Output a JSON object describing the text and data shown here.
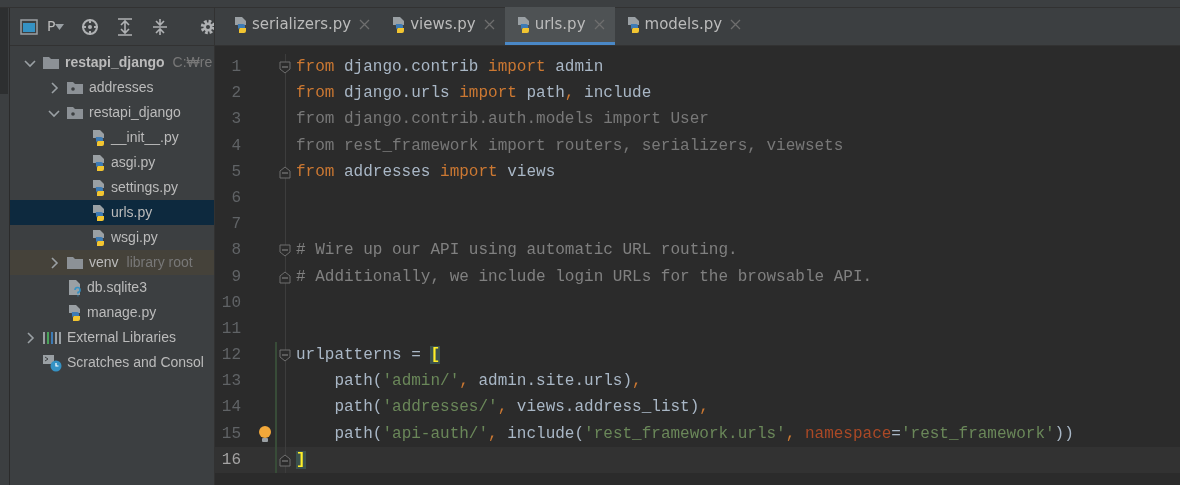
{
  "project_panel": {
    "view_label": "P"
  },
  "tree": [
    {
      "label": "restapi_django",
      "hint": "C:₩re",
      "kind": "project",
      "expanded": true,
      "selected": false,
      "children": [
        {
          "label": "addresses",
          "kind": "module",
          "expanded": false,
          "selected": false
        },
        {
          "label": "restapi_django",
          "kind": "module",
          "expanded": true,
          "selected": false,
          "children": [
            {
              "label": "__init__.py",
              "kind": "python",
              "selected": false
            },
            {
              "label": "asgi.py",
              "kind": "python",
              "selected": false
            },
            {
              "label": "settings.py",
              "kind": "python",
              "selected": false
            },
            {
              "label": "urls.py",
              "kind": "python",
              "selected": true
            },
            {
              "label": "wsgi.py",
              "kind": "python",
              "selected": false
            }
          ]
        },
        {
          "label": "venv",
          "hint": "library root",
          "kind": "library-folder",
          "expanded": false,
          "selected": false
        },
        {
          "label": "db.sqlite3",
          "kind": "unknown-file",
          "selected": false
        },
        {
          "label": "manage.py",
          "kind": "python",
          "selected": false
        }
      ]
    },
    {
      "label": "External Libraries",
      "kind": "libraries",
      "expanded": false,
      "selected": false
    },
    {
      "label": "Scratches and Consol",
      "kind": "scratches",
      "selected": false
    }
  ],
  "editor_tabs": [
    {
      "label": "serializers.py",
      "selected": false
    },
    {
      "label": "views.py",
      "selected": false
    },
    {
      "label": "urls.py",
      "selected": true
    },
    {
      "label": "models.py",
      "selected": false
    }
  ],
  "lines": [
    {
      "number": "1",
      "kind": "open",
      "current": false,
      "changed": false,
      "bulb": false,
      "tokens": [
        {
          "t": "from",
          "kind": "kw"
        },
        {
          "t": " django.contrib ",
          "kind": "id"
        },
        {
          "t": "import",
          "kind": "kw"
        },
        {
          "t": " admin",
          "kind": "id"
        }
      ]
    },
    {
      "number": "2",
      "kind": "plain",
      "current": false,
      "changed": false,
      "bulb": false,
      "tokens": [
        {
          "t": "from",
          "kind": "kw"
        },
        {
          "t": " django.urls ",
          "kind": "id"
        },
        {
          "t": "import",
          "kind": "kw"
        },
        {
          "t": " path",
          "kind": "id"
        },
        {
          "t": ",",
          "kind": "punct"
        },
        {
          "t": " include",
          "kind": "id"
        }
      ]
    },
    {
      "number": "3",
      "kind": "plain",
      "current": false,
      "changed": false,
      "bulb": false,
      "tokens": [
        {
          "t": "from django.contrib.auth.models import User",
          "kind": "unused"
        }
      ]
    },
    {
      "number": "4",
      "kind": "plain",
      "current": false,
      "changed": false,
      "bulb": false,
      "tokens": [
        {
          "t": "from rest_framework import routers, serializers, viewsets",
          "kind": "unused"
        }
      ]
    },
    {
      "number": "5",
      "kind": "close",
      "current": false,
      "changed": false,
      "bulb": false,
      "tokens": [
        {
          "t": "from",
          "kind": "kw"
        },
        {
          "t": " addresses ",
          "kind": "id"
        },
        {
          "t": "import",
          "kind": "kw"
        },
        {
          "t": " views",
          "kind": "id"
        }
      ]
    },
    {
      "number": "6",
      "kind": "plain",
      "current": false,
      "changed": false,
      "bulb": false
    },
    {
      "number": "7",
      "kind": "plain",
      "current": false,
      "changed": false,
      "bulb": false
    },
    {
      "number": "8",
      "kind": "open",
      "current": false,
      "changed": false,
      "bulb": false,
      "tokens": [
        {
          "t": "# Wire up our API using automatic URL routing.",
          "kind": "comment"
        }
      ]
    },
    {
      "number": "9",
      "kind": "close",
      "current": false,
      "changed": false,
      "bulb": false,
      "tokens": [
        {
          "t": "# Additionally, we include login URLs for the browsable API.",
          "kind": "comment"
        }
      ]
    },
    {
      "number": "10",
      "kind": "plain",
      "current": false,
      "changed": false,
      "bulb": false
    },
    {
      "number": "11",
      "kind": "plain",
      "current": false,
      "changed": false,
      "bulb": false
    },
    {
      "number": "12",
      "kind": "open",
      "current": false,
      "changed": true,
      "bulb": false,
      "tokens": [
        {
          "t": "urlpatterns = ",
          "kind": "id"
        },
        {
          "t": "[",
          "kind": "match"
        }
      ]
    },
    {
      "number": "13",
      "kind": "plain",
      "current": false,
      "changed": true,
      "bulb": false,
      "tokens": [
        {
          "t": "    path(",
          "kind": "id"
        },
        {
          "t": "'admin/'",
          "kind": "str"
        },
        {
          "t": ",",
          "kind": "punct"
        },
        {
          "t": " admin.site.urls)",
          "kind": "id"
        },
        {
          "t": ",",
          "kind": "punct"
        }
      ]
    },
    {
      "number": "14",
      "kind": "plain",
      "current": false,
      "changed": true,
      "bulb": false,
      "tokens": [
        {
          "t": "    path(",
          "kind": "id"
        },
        {
          "t": "'addresses/'",
          "kind": "str"
        },
        {
          "t": ",",
          "kind": "punct"
        },
        {
          "t": " views.address_list)",
          "kind": "id"
        },
        {
          "t": ",",
          "kind": "punct"
        }
      ]
    },
    {
      "number": "15",
      "kind": "plain",
      "current": false,
      "changed": true,
      "bulb": true,
      "tokens": [
        {
          "t": "    path(",
          "kind": "id"
        },
        {
          "t": "'api-auth/'",
          "kind": "str"
        },
        {
          "t": ",",
          "kind": "punct"
        },
        {
          "t": " include(",
          "kind": "id"
        },
        {
          "t": "'rest_framework.urls'",
          "kind": "str"
        },
        {
          "t": ", ",
          "kind": "punct"
        },
        {
          "t": "namespace",
          "kind": "param"
        },
        {
          "t": "=",
          "kind": "id"
        },
        {
          "t": "'rest_framework'",
          "kind": "str"
        },
        {
          "t": "))",
          "kind": "id"
        }
      ]
    },
    {
      "number": "16",
      "kind": "close",
      "current": true,
      "changed": true,
      "bulb": false,
      "tokens": [
        {
          "t": "]",
          "kind": "match"
        }
      ]
    }
  ]
}
